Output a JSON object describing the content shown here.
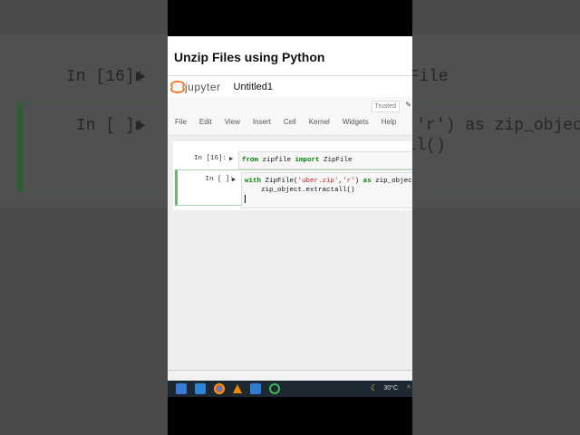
{
  "video_title": "Unzip Files using Python",
  "jupyter": {
    "logo_text": "jupyter",
    "notebook_name": "Untitled1",
    "trusted_label": "Trusted"
  },
  "menu": [
    "File",
    "Edit",
    "View",
    "Insert",
    "Cell",
    "Kernel",
    "Widgets",
    "Help"
  ],
  "cells": [
    {
      "prompt": "In [16]:",
      "code_lines": [
        "from zipfile import ZipFile"
      ]
    },
    {
      "prompt": "In [ ]:",
      "code_lines": [
        "with ZipFile('uber.zip','r') as zip_object:",
        "    zip_object.extractall()"
      ]
    }
  ],
  "taskbar": {
    "temperature": "30°C",
    "icons": [
      "store-icon",
      "mail-icon",
      "chrome-icon",
      "vlc-icon",
      "photos-icon",
      "circle-app-icon"
    ]
  },
  "colors": {
    "selected_cell": "#66bb6a",
    "taskbar": "#1e2833",
    "jupyter_orange": "#f37726"
  }
}
